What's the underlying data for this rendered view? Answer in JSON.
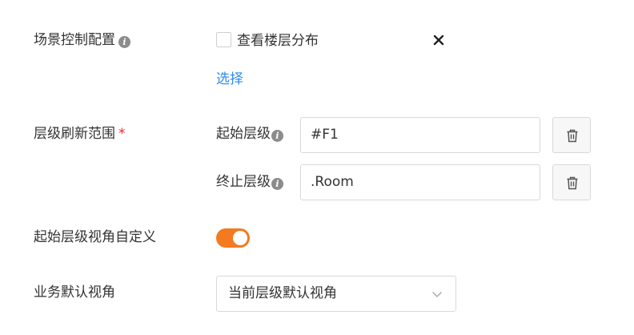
{
  "scene_control": {
    "label": "场景控制配置",
    "checkbox_label": "查看楼层分布",
    "checked": false,
    "select_link": "选择"
  },
  "floor_range": {
    "label": "层级刷新范围",
    "required_mark": "*",
    "start": {
      "label": "起始层级",
      "value": "#F1"
    },
    "end": {
      "label": "终止层级",
      "value": ".Room"
    }
  },
  "custom_view": {
    "label": "起始层级视角自定义",
    "enabled": true
  },
  "default_view": {
    "label": "业务默认视角",
    "selected": "当前层级默认视角"
  },
  "colors": {
    "accent": "#f47a1f",
    "link": "#2d8cf0",
    "required": "#f5222d"
  }
}
